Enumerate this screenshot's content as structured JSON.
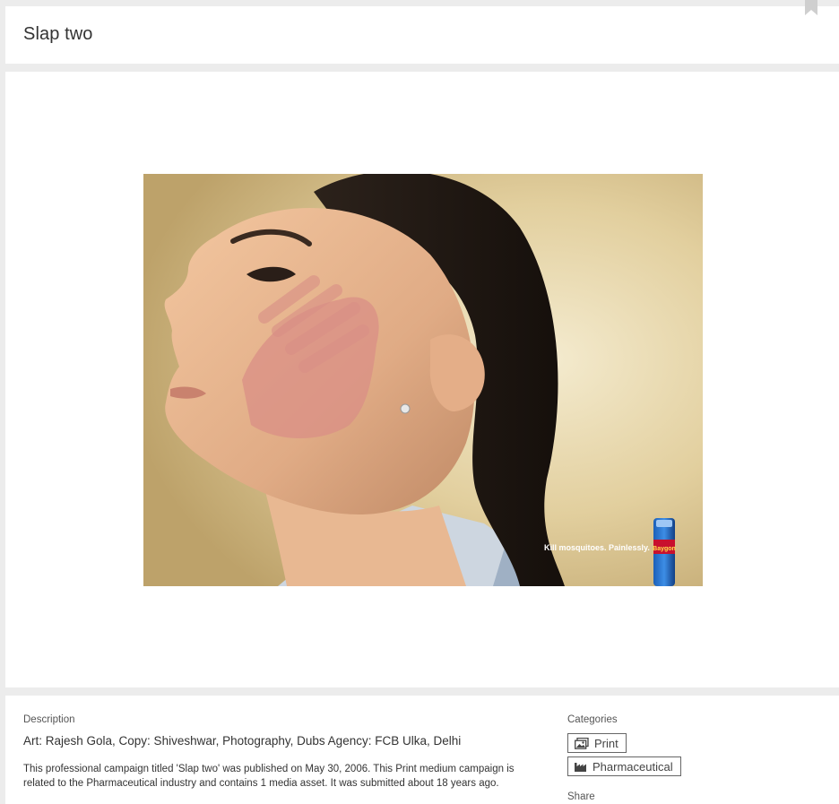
{
  "header": {
    "title": "Slap two",
    "bookmark_icon": "bookmark-icon"
  },
  "media": {
    "tagline": "Kill mosquitoes. Painlessly.",
    "product_label": "Baygon"
  },
  "details": {
    "description_label": "Description",
    "credits": "Art: Rajesh Gola, Copy: Shiveshwar, Photography, Dubs Agency: FCB Ulka, Delhi",
    "summary": "This professional campaign titled 'Slap two' was published on May 30, 2006. This Print medium campaign is related to the Pharmaceutical industry and contains 1 media asset. It was submitted about 18 years ago.",
    "categories_label": "Categories",
    "categories": [
      {
        "label": "Print",
        "icon": "print-media-icon"
      },
      {
        "label": "Pharmaceutical",
        "icon": "industry-icon"
      }
    ],
    "share_label": "Share"
  },
  "colors": {
    "background": "#ececec",
    "card": "#ffffff",
    "text": "#333333",
    "border": "#666666"
  }
}
